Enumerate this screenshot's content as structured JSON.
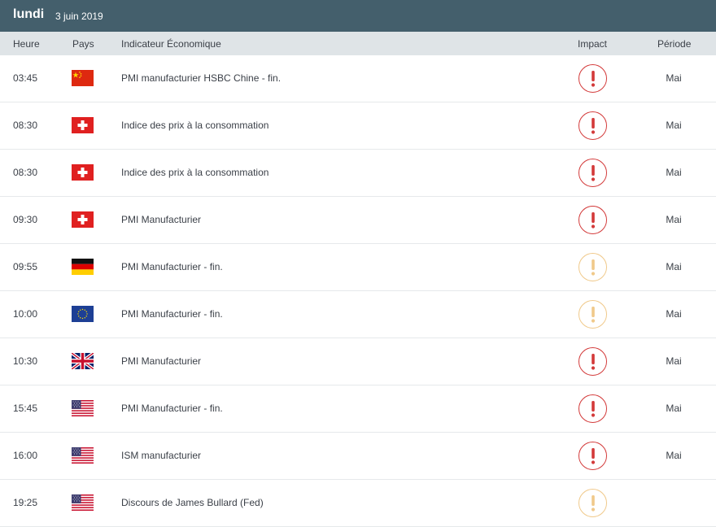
{
  "header": {
    "day": "lundi",
    "date": "3 juin 2019",
    "color": "#445f6c"
  },
  "columns": {
    "time": "Heure",
    "country": "Pays",
    "indicator": "Indicateur Économique",
    "impact": "Impact",
    "period": "Période"
  },
  "impact_colors": {
    "high": "#d33a3a",
    "medium": "#f0c98a"
  },
  "events": [
    {
      "time": "03:45",
      "country": "china",
      "flag_icon": "china-flag-icon",
      "indicator": "PMI manufacturier HSBC Chine - fin.",
      "impact": "high",
      "period": "Mai"
    },
    {
      "time": "08:30",
      "country": "switzerland",
      "flag_icon": "switzerland-flag-icon",
      "indicator": "Indice des prix à la consommation",
      "impact": "high",
      "period": "Mai"
    },
    {
      "time": "08:30",
      "country": "switzerland",
      "flag_icon": "switzerland-flag-icon",
      "indicator": "Indice des prix à la consommation",
      "impact": "high",
      "period": "Mai"
    },
    {
      "time": "09:30",
      "country": "switzerland",
      "flag_icon": "switzerland-flag-icon",
      "indicator": "PMI Manufacturier",
      "impact": "high",
      "period": "Mai"
    },
    {
      "time": "09:55",
      "country": "germany",
      "flag_icon": "germany-flag-icon",
      "indicator": "PMI Manufacturier - fin.",
      "impact": "medium",
      "period": "Mai"
    },
    {
      "time": "10:00",
      "country": "eurozone",
      "flag_icon": "eu-flag-icon",
      "indicator": "PMI Manufacturier - fin.",
      "impact": "medium",
      "period": "Mai"
    },
    {
      "time": "10:30",
      "country": "uk",
      "flag_icon": "uk-flag-icon",
      "indicator": "PMI Manufacturier",
      "impact": "high",
      "period": "Mai"
    },
    {
      "time": "15:45",
      "country": "usa",
      "flag_icon": "usa-flag-icon",
      "indicator": "PMI Manufacturier - fin.",
      "impact": "high",
      "period": "Mai"
    },
    {
      "time": "16:00",
      "country": "usa",
      "flag_icon": "usa-flag-icon",
      "indicator": "ISM manufacturier",
      "impact": "high",
      "period": "Mai"
    },
    {
      "time": "19:25",
      "country": "usa",
      "flag_icon": "usa-flag-icon",
      "indicator": "Discours de James Bullard (Fed)",
      "impact": "medium",
      "period": ""
    }
  ]
}
